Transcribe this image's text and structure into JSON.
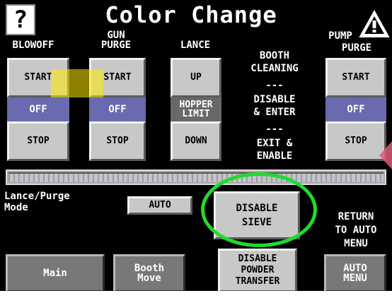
{
  "header": {
    "title": "Color Change",
    "help_label": "?"
  },
  "columns": {
    "blowoff": {
      "label": "BLOWOFF",
      "start": "START",
      "status": "OFF",
      "stop": "STOP"
    },
    "gun_purge": {
      "label": "GUN\nPURGE",
      "start": "START",
      "status": "OFF",
      "stop": "STOP"
    },
    "lance": {
      "label": "LANCE",
      "up": "UP",
      "status": "HOPPER\nLIMIT",
      "down": "DOWN"
    },
    "pump_purge": {
      "label_pump": "PUMP",
      "label_purge": "PURGE",
      "start": "START",
      "status": "OFF",
      "stop": "STOP"
    }
  },
  "booth_cleaning": {
    "line1": "BOOTH\nCLEANING",
    "sep1": "---",
    "line2": "DISABLE\n& ENTER",
    "sep2": "---",
    "line3": "EXIT &\nENABLE"
  },
  "progress": {
    "fill_fraction": 1.0
  },
  "lance_purge_mode": {
    "label": "Lance/Purge\nMode",
    "button": "AUTO"
  },
  "disable_sieve": {
    "label": "DISABLE\nSIEVE"
  },
  "return_text": "RETURN\nTO AUTO\nMENU",
  "bottom": {
    "main": "Main",
    "booth_move": "Booth\nMove",
    "disable_powder": "DISABLE\nPOWDER\nTRANSFER",
    "auto_menu": "AUTO\nMENU"
  },
  "colors": {
    "status_off": "#6a6ab0",
    "button_face": "#c8c8c8",
    "highlight": "#ffeb00",
    "annotation_ellipse": "#1fdc2c"
  }
}
